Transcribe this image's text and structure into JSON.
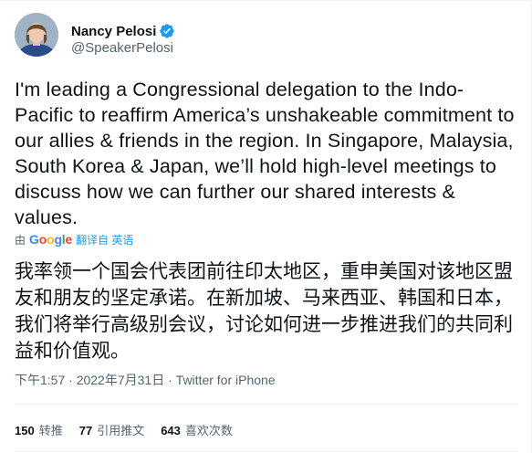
{
  "author": {
    "name": "Nancy Pelosi",
    "handle": "@SpeakerPelosi",
    "verified": true
  },
  "tweet": {
    "text": "I'm leading a Congressional delegation to the Indo-Pacific to reaffirm America’s unshakeable commitment to our allies & friends in the region. In Singapore, Malaysia, South Korea & Japan, we’ll hold high-level meetings to discuss how we can further our shared interests & values."
  },
  "translation": {
    "by_label": "由",
    "provider": "Google",
    "link_label": "翻译自 英语",
    "text": "我率领一个国会代表团前往印太地区，重申美国对该地区盟友和朋友的坚定承诺。在新加坡、马来西亚、韩国和日本，我们将举行高级别会议，讨论如何进一步推进我们的共同利益和价值观。"
  },
  "meta": {
    "time": "下午1:57",
    "separator": " · ",
    "date": "2022年7月31日",
    "source": "Twitter for iPhone"
  },
  "stats": {
    "retweets_count": "150",
    "retweets_label": "转推",
    "quotes_count": "77",
    "quotes_label": "引用推文",
    "likes_count": "643",
    "likes_label": "喜欢次数"
  },
  "colors": {
    "text": "#0f1419",
    "secondary": "#536471",
    "link": "#1d9bf0",
    "verified": "#1d9bf0",
    "divider": "#eff3f4"
  },
  "icons": [
    "avatar-photo",
    "verified-badge-icon",
    "google-logo"
  ]
}
